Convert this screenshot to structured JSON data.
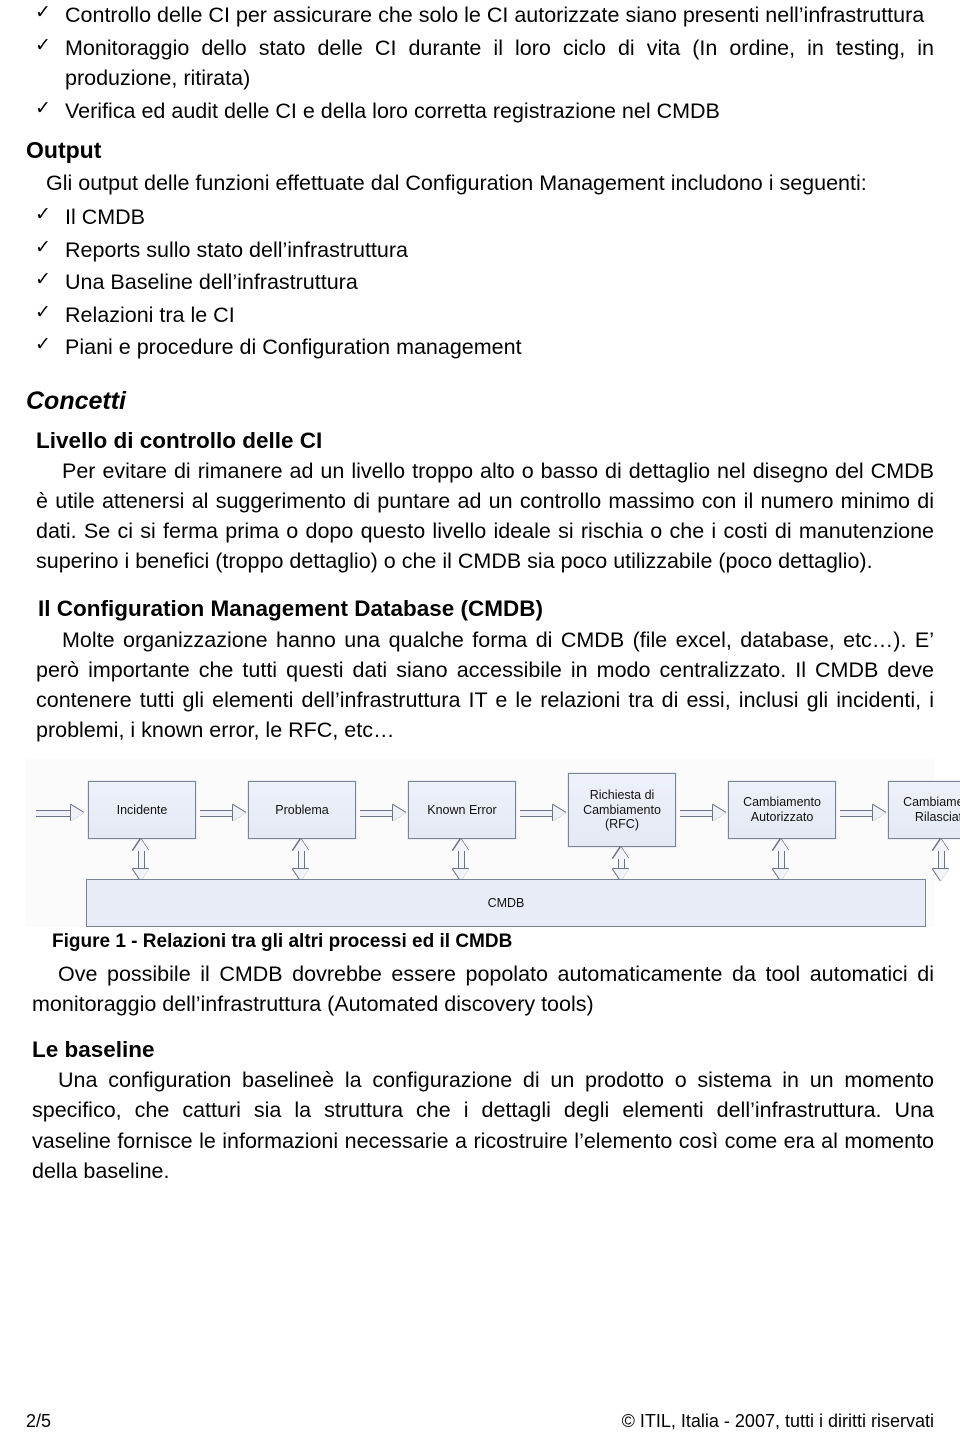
{
  "top_bullets": [
    {
      "tick": "✓",
      "text": "Controllo delle CI per assicurare che solo le CI autorizzate siano presenti nell’infrastruttura"
    },
    {
      "tick": "✓",
      "text": "Monitoraggio dello stato delle CI durante il loro ciclo di vita (In ordine, in testing, in produzione, ritirata)"
    },
    {
      "tick": "✓",
      "text": "Verifica ed audit delle CI e della loro corretta registrazione nel CMDB"
    }
  ],
  "output_section": {
    "heading": "Output",
    "lead": "Gli output delle funzioni effettuate dal Configuration Management includono i seguenti:",
    "bullets": [
      {
        "tick": "✓",
        "text": "Il CMDB"
      },
      {
        "tick": "✓",
        "text": "Reports sullo stato dell’infrastruttura"
      },
      {
        "tick": "✓",
        "text": "Una Baseline dell’infrastruttura"
      },
      {
        "tick": "✓",
        "text": "Relazioni tra le CI"
      },
      {
        "tick": "✓",
        "text": "Piani e procedure di Configuration management"
      }
    ]
  },
  "concetti_heading": "Concetti",
  "livello_section": {
    "heading": "Livello di controllo delle CI",
    "body": "Per evitare di rimanere ad un livello troppo alto o basso di dettaglio nel disegno del CMDB è utile attenersi al suggerimento di puntare ad un controllo massimo con il numero minimo di dati. Se ci si ferma prima o dopo questo livello ideale si rischia o che i costi di manutenzione superino i benefici (troppo dettaglio) o che il CMDB sia poco utilizzabile (poco dettaglio)."
  },
  "cmdb_section": {
    "heading": "Il Configuration Management Database (CMDB)",
    "body": "Molte organizzazione hanno una qualche forma di CMDB (file excel, database, etc…). E’ però importante che tutti questi dati siano accessibile in modo centralizzato. Il CMDB deve contenere tutti gli elementi dell’infrastruttura IT e le relazioni tra di essi, inclusi gli incidenti, i problemi, i known error, le  RFC, etc…"
  },
  "figure": {
    "caption": "Figure 1 -  Relazioni tra gli altri processi ed il CMDB",
    "nodes": [
      {
        "label": "Incidente"
      },
      {
        "label": "Problema"
      },
      {
        "label": "Known Error"
      },
      {
        "label": "Richiesta di Cambiamento (RFC)"
      },
      {
        "label": "Cambiamento Autorizzato"
      },
      {
        "label": "Cambiamento Rilasciato"
      }
    ],
    "repository_label": "CMDB",
    "box_fill": "#e8ecf6",
    "box_border": "#7a8296",
    "arrow_fill": "#eef1f7"
  },
  "after_figure": {
    "body": "Ove possibile il CMDB dovrebbe essere popolato automaticamente da tool automatici di monitoraggio dell’infrastruttura (Automated discovery tools)"
  },
  "baseline_section": {
    "heading": "Le baseline",
    "body": "Una configuration baselineè la configurazione di un prodotto o sistema in un momento specifico, che catturi sia la struttura che i dettagli degli elementi dell’infrastruttura. Una vaseline fornisce le informazioni necessarie a ricostruire l’elemento così come era al momento della baseline."
  },
  "footer": {
    "page_number": "2/5",
    "copyright": "© ITIL, Italia - 2007, tutti i diritti riservati"
  }
}
